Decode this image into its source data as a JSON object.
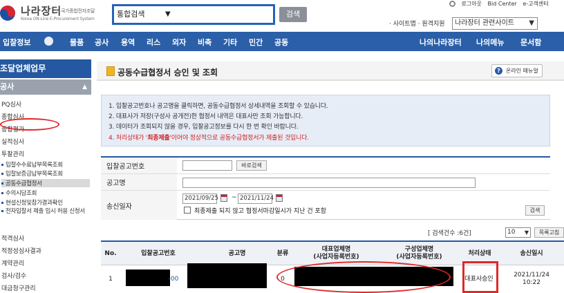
{
  "header": {
    "logo_title": "나라장터",
    "logo_tag": "국가종합전자조달",
    "logo_sub": "Korea ON-Line E-Procurement System",
    "search_select_value": "통합검색",
    "search_button": "검색",
    "top_links": [
      "로그아웃",
      "Bid Center",
      "e-고객센터"
    ],
    "util_links": "· 사이트맵 · 원격지원",
    "site_select_value": "나라장터 관련사이트"
  },
  "nav": {
    "items": [
      "입찰정보",
      "물품",
      "공사",
      "용역",
      "리스",
      "외자",
      "비축",
      "기타",
      "민간",
      "공동"
    ],
    "right_items": [
      "나의나라장터",
      "나의메뉴",
      "문서함"
    ]
  },
  "sidebar": {
    "title": "조달업체업무",
    "section": "공사",
    "items_top": [
      "PQ심사",
      "종합심사",
      "종합평가",
      "실적심사",
      "투찰관리"
    ],
    "children": [
      "입찰수수료납부목록조회",
      "입찰보증금납부목록조회",
      "공동수급협정서",
      "수의시담조회",
      "현설신청및참가결과확인",
      "전자입찰서 제출 임시 허용 신청서"
    ],
    "items_bottom": [
      "적격심사",
      "적정성심사결과",
      "계약관리",
      "검사/검수",
      "대금청구관리"
    ]
  },
  "content": {
    "page_title": "공동수급협정서 승인 및 조회",
    "manual_button": "온라인 매뉴얼",
    "info": [
      "1. 입찰공고번호나 공고명을 클릭하면, 공동수급협정서 상세내역을 조회할 수 있습니다.",
      "2. 대표사가 저장(구성사 공개전)한 협정서 내역은 대표사만 조회 가능합니다.",
      "3. 데이터가 조회되지 않을 경우, 입찰공고정보를 다시 한 번 확인 바랍니다."
    ],
    "info_red_prefix": "4. 처리상태가 '",
    "info_red_bold": "최종제출",
    "info_red_suffix": "'이어야 정상적으로 공동수급협정서가 제출된 것입니다."
  },
  "form": {
    "bid_no_label": "입찰공고번호",
    "bid_no_value": "",
    "bid_search_button": "바로검색",
    "notice_name_label": "공고명",
    "notice_name_value": "",
    "send_date_label": "송신일자",
    "date_from": "2021/09/25",
    "date_separator": "~",
    "date_to": "2021/11/24",
    "checkbox_label": "최종제출 되지 않고 협정서마감일시가 지난 건 포함",
    "search_button": "검색"
  },
  "list": {
    "count_text": "[ 검색건수 :6건]",
    "page_size": "10",
    "list_button": "목록고침",
    "headers": [
      "No.",
      "입찰공고번호",
      "공고명",
      "분류",
      "대표업체명\n(사업자등록번호)",
      "구성업체명\n(사업자등록번호)",
      "처리상태",
      "송신일시"
    ],
    "rows": [
      {
        "no": "1",
        "bid_no_suffix": "-00",
        "category": "0",
        "status": "대표사승인",
        "sent_date": "2021/11/24",
        "sent_time": "10:22"
      }
    ]
  },
  "colors": {
    "nav_bg": "#2b5fa8",
    "sidebar_title_bg": "#2458a2",
    "annotation_red": "#e02828"
  }
}
